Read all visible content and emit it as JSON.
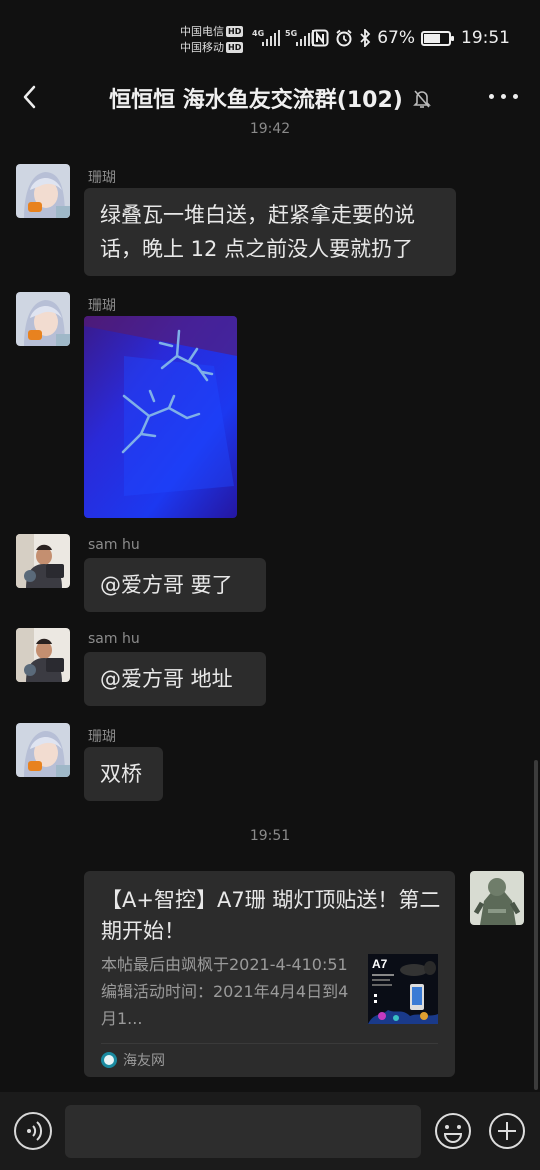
{
  "status_bar": {
    "carrier1": "中国电信",
    "carrier2": "中国移动",
    "hd_badge": "HD",
    "net1": "4G",
    "net2": "5G",
    "icons": [
      "nfc-icon",
      "alarm-icon",
      "bluetooth-icon"
    ],
    "battery_text": "67%",
    "battery_level": 0.67,
    "time": "19:51"
  },
  "header": {
    "title": "恒恒恒  海水鱼友交流群(102)",
    "back_icon": "back-arrow-icon",
    "mute_icon": "bell-muted-icon",
    "more_icon": "more-dots-icon"
  },
  "messages": [
    {
      "sender": "珊瑚",
      "type": "text",
      "text": "绿叠瓦一堆白送，赶紧拿走要的说话，晚上 12 点之前没人要就扔了"
    },
    {
      "sender": "珊瑚",
      "type": "image"
    },
    {
      "sender": "sam hu",
      "type": "text",
      "text": "@爱方哥  要了"
    },
    {
      "sender": "sam hu",
      "type": "text",
      "text": "@爱方哥  地址"
    },
    {
      "sender": "珊瑚",
      "type": "text",
      "text": "双桥"
    }
  ],
  "timestamps": {
    "top_partial": "19:42",
    "middle": "19:51"
  },
  "link_card": {
    "title": "【A+智控】A7珊 瑚灯顶贴送！第二期开始！",
    "description": "本帖最后由飒枫于2021-4-410:51编辑活动时间：2021年4月4日到4月1...",
    "thumb_label": "A7",
    "source": "海友网"
  },
  "input_bar": {
    "placeholder": "",
    "voice_icon": "voice-icon",
    "emoji_icon": "emoji-icon",
    "plus_icon": "plus-icon"
  },
  "colors": {
    "background": "#111111",
    "bubble": "#2c2c2c",
    "text": "#e8e8e8",
    "muted": "#8c8c8c"
  }
}
